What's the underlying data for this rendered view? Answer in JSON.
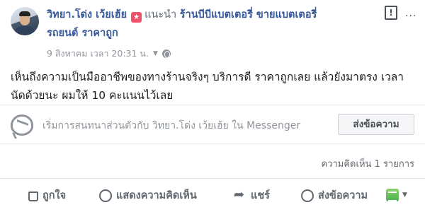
{
  "post": {
    "author": "วิทยา.โด่ง เว้ยเฮ้ย",
    "recommend_text": "แนะนำ",
    "page_name_line1": "ร้านบีบีแบตเตอรี่ ขายแบตเตอรี่",
    "page_name_line2": "รถยนต์ ราคาถูก",
    "timestamp": "9 สิงหาคม เวลา 20:31 น.",
    "privacy_icon": "globe-icon",
    "body": "เห็นถึงความเป็นมืออาชีพของทางร้านจริงๆ บริการดี ราคาถูกเลย แล้วยังมาตรง เวลานัดด้วยนะ ผมให้ 10 คะแนนไว้เลย",
    "rating_icon_color": "#f25268"
  },
  "messenger": {
    "prompt": "เริ่มการสนทนาส่วนตัวกับ วิทยา.โด่ง เว้ยเฮ้ย ใน Messenger",
    "send_button": "ส่งข้อความ"
  },
  "stats": {
    "comment_count": "ความคิดเห็น 1 รายการ"
  },
  "actions": {
    "like": "ถูกใจ",
    "comment": "แสดงความคิดเห็น",
    "share": "แชร์",
    "message": "ส่งข้อความ"
  },
  "colors": {
    "link": "#385898",
    "muted": "#90949c",
    "action": "#606770"
  }
}
